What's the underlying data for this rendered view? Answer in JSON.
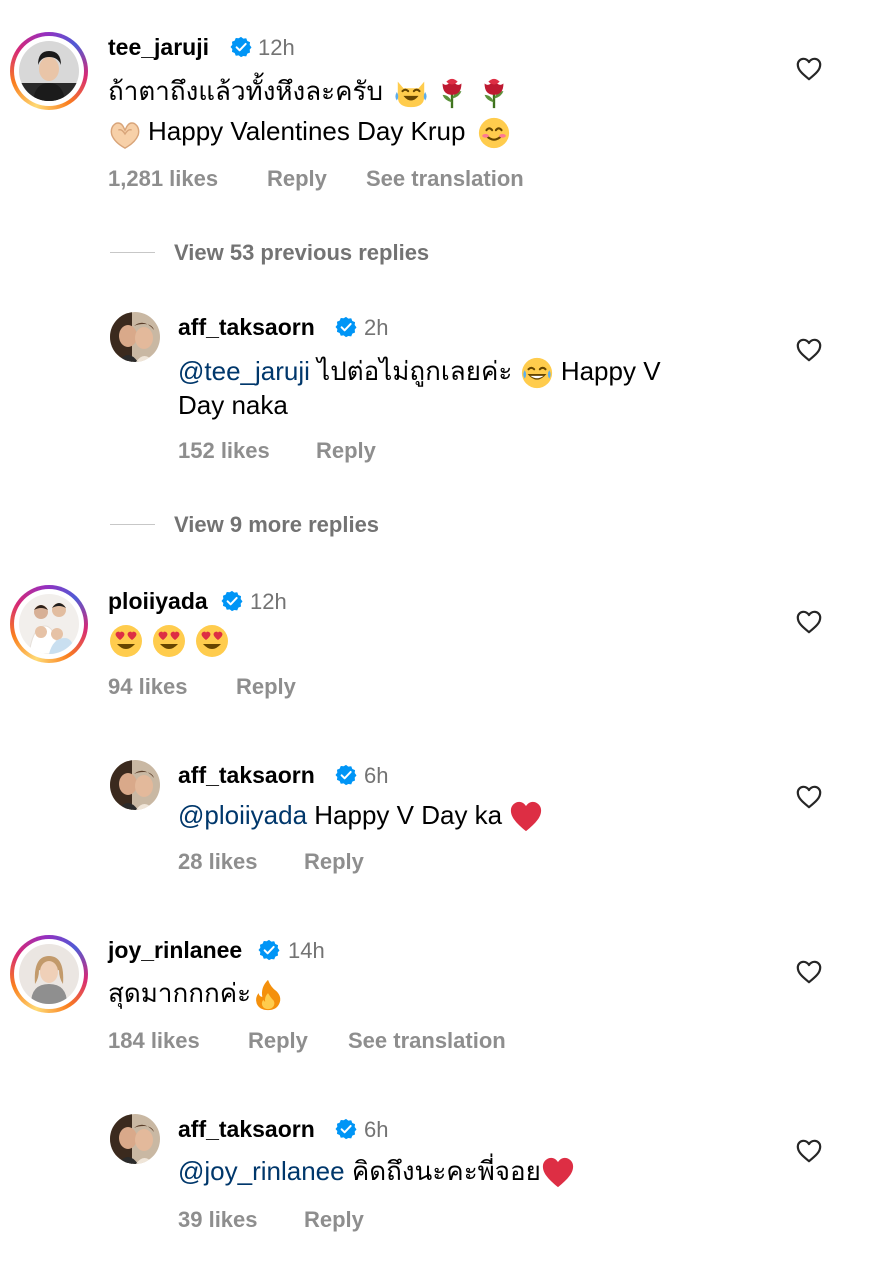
{
  "comments": [
    {
      "username": "tee_jaruji",
      "time": "12h",
      "text_line1": "ถ้าตาถึงแล้วทั้งหึงละครับ",
      "text_line2": "Happy Valentines Day Krup",
      "likes": "1,281 likes",
      "reply": "Reply",
      "translate": "See translation",
      "view_replies": "View 53 previous replies",
      "replies": [
        {
          "username": "aff_taksaorn",
          "time": "2h",
          "mention": "@tee_jaruji",
          "text_line1": "ไปต่อไม่ถูกเลยค่ะ",
          "text_line1b": "Happy V",
          "text_line2": "Day naka",
          "likes": "152 likes",
          "reply": "Reply"
        }
      ],
      "more_replies": "View 9 more replies"
    },
    {
      "username": "ploiiyada",
      "time": "12h",
      "likes": "94 likes",
      "reply": "Reply",
      "replies": [
        {
          "username": "aff_taksaorn",
          "time": "6h",
          "mention": "@ploiiyada",
          "text": "Happy V Day ka",
          "likes": "28 likes",
          "reply": "Reply"
        }
      ]
    },
    {
      "username": "joy_rinlanee",
      "time": "14h",
      "text": "สุดมากกกค่ะ",
      "likes": "184 likes",
      "reply": "Reply",
      "translate": "See translation",
      "replies": [
        {
          "username": "aff_taksaorn",
          "time": "6h",
          "mention": "@joy_rinlanee",
          "text": "คิดถึงนะคะพี่จอย",
          "likes": "39 likes",
          "reply": "Reply"
        }
      ]
    }
  ],
  "colors": {
    "verified": "#0095f6",
    "mention": "#00376b",
    "meta": "#8e8e8e",
    "time": "#737373"
  },
  "icons": [
    "verified-badge-icon",
    "heart-outline-icon"
  ]
}
